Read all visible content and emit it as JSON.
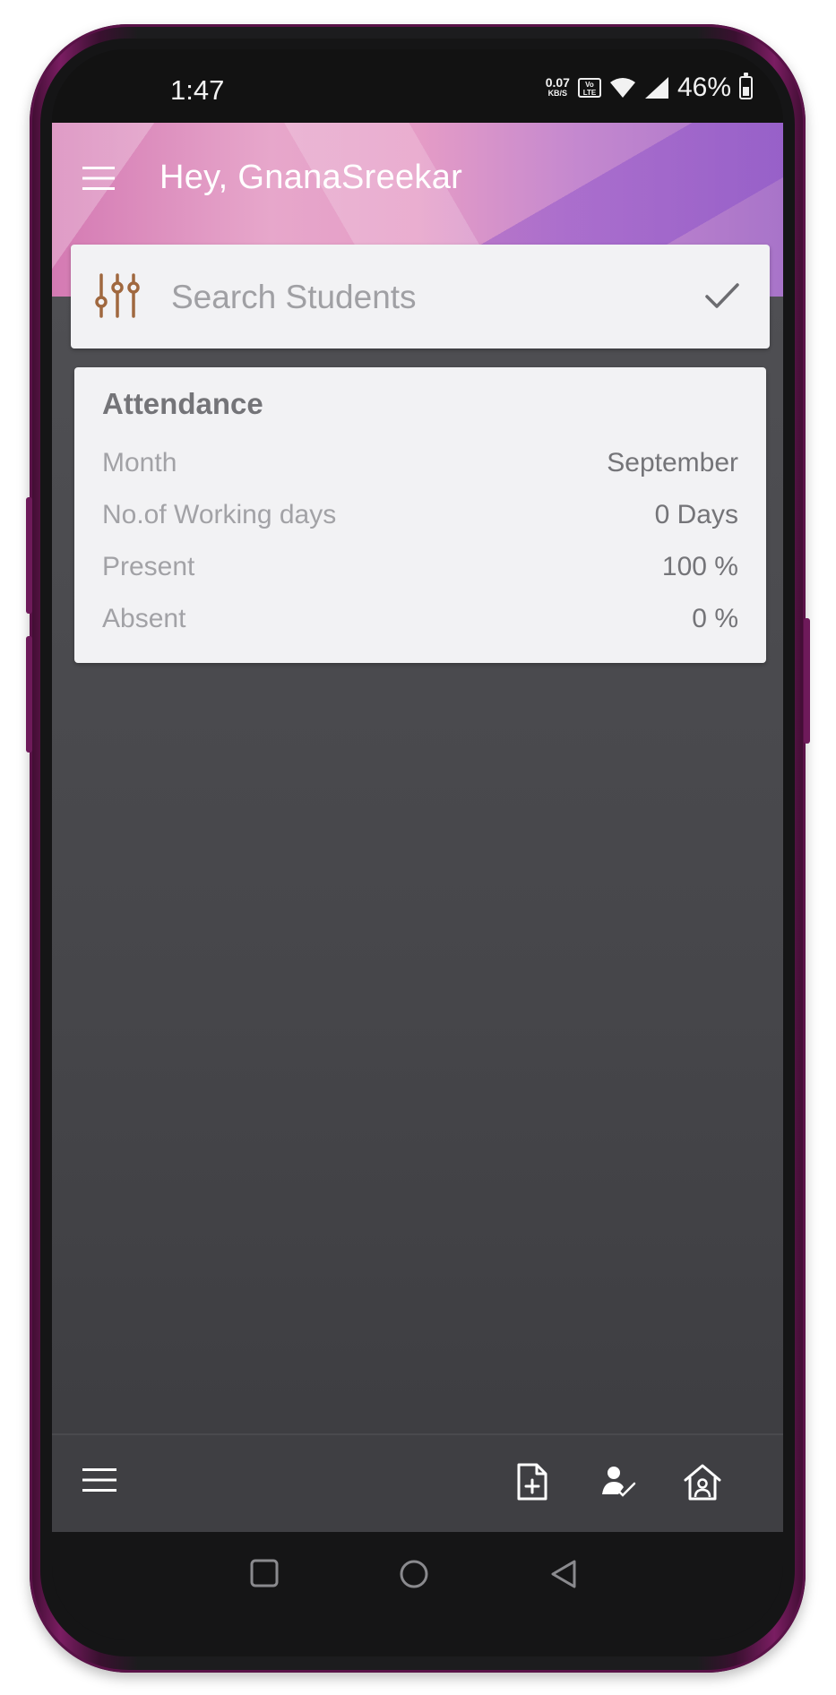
{
  "status_bar": {
    "time": "1:47",
    "net_speed_value": "0.07",
    "net_speed_unit": "KB/S",
    "volte_label_top": "Vo",
    "volte_label_bottom": "LTE",
    "battery_percent": "46%"
  },
  "app_bar": {
    "greeting": "Hey, GnanaSreekar",
    "menu_icon": "hamburger-menu-icon"
  },
  "search": {
    "placeholder": "Search Students",
    "value": "",
    "filter_icon": "sliders-icon",
    "confirm_icon": "checkmark-icon"
  },
  "attendance": {
    "title": "Attendance",
    "rows": [
      {
        "label": "Month",
        "value": "September"
      },
      {
        "label": "No.of Working days",
        "value": "0 Days"
      },
      {
        "label": "Present",
        "value": "100 %"
      },
      {
        "label": "Absent",
        "value": "0 %"
      }
    ]
  },
  "bottom_bar": {
    "left_icon": "hamburger-menu-icon",
    "right_icons": [
      "add-document-icon",
      "student-checkmark-icon",
      "home-icon"
    ]
  },
  "colors": {
    "accent_filter": "#a0683f",
    "card_bg": "#f2f2f4",
    "content_bg": "#48484c",
    "frame_accent": "#7a1d62"
  }
}
